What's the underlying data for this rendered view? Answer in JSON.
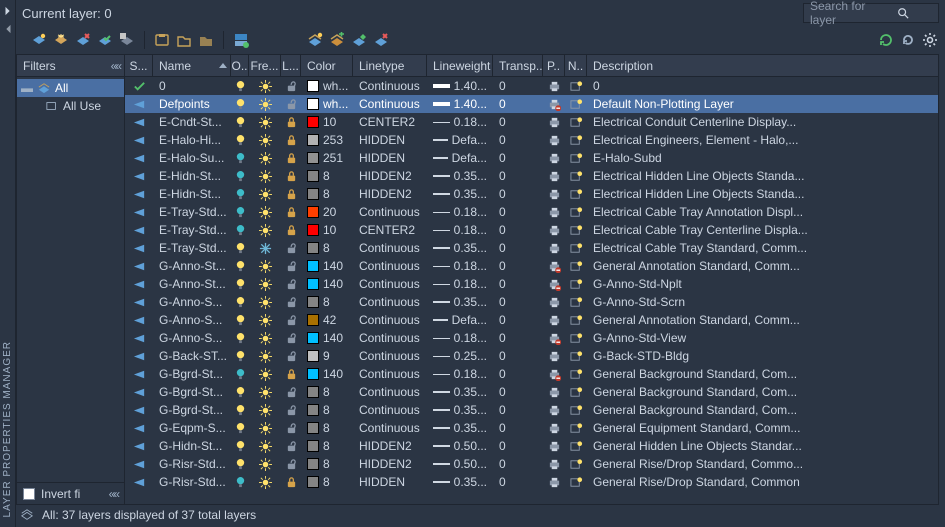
{
  "header": {
    "current_layer_label": "Current layer: 0",
    "search_placeholder": "Search for layer"
  },
  "vertical_label": "LAYER PROPERTIES MANAGER",
  "filters": {
    "title": "Filters",
    "items": [
      {
        "name": "All",
        "selected": true
      },
      {
        "name": "All Use",
        "selected": false
      }
    ],
    "invert_label": "Invert fi"
  },
  "columns": {
    "status": "S...",
    "name": "Name",
    "on": "O..",
    "freeze": "Fre...",
    "lock": "L...",
    "color": "Color",
    "linetype": "Linetype",
    "lineweight": "Lineweight",
    "transp": "Transp...",
    "plotstyle": "P..",
    "newvp": "N..",
    "desc": "Description"
  },
  "rows": [
    {
      "status": "check",
      "name": "0",
      "on": true,
      "freeze": "sun",
      "lock": false,
      "color": "#ffffff",
      "color_label": "wh...",
      "linetype": "Continuous",
      "lw": "1.40...",
      "lw_cls": "thick",
      "transp": "0",
      "plot": "print",
      "desc": "0"
    },
    {
      "status": "layer",
      "name": "Defpoints",
      "on": true,
      "freeze": "sun",
      "lock": false,
      "color": "#ffffff",
      "color_label": "wh...",
      "linetype": "Continuous",
      "lw": "1.40...",
      "lw_cls": "thick",
      "transp": "0",
      "plot": "noprint",
      "desc": "Default Non-Plotting Layer",
      "selected": true
    },
    {
      "status": "layer",
      "name": "E-Cndt-St...",
      "on": true,
      "freeze": "sun",
      "lock": true,
      "color": "#ff0000",
      "color_label": "10",
      "linetype": "CENTER2",
      "lw": "0.18...",
      "lw_cls": "thin",
      "transp": "0",
      "plot": "print",
      "desc": "Electrical Conduit Centerline Display..."
    },
    {
      "status": "layer",
      "name": "E-Halo-Hi...",
      "on": true,
      "freeze": "sun",
      "lock": true,
      "color": "#b2b2b2",
      "color_label": "253",
      "linetype": "HIDDEN",
      "lw": "Defa...",
      "lw_cls": "def",
      "transp": "0",
      "plot": "print",
      "desc": "Electrical Engineers, Element - Halo,..."
    },
    {
      "status": "layer",
      "name": "E-Halo-Su...",
      "on": false,
      "freeze": "sun",
      "lock": true,
      "color": "#919191",
      "color_label": "251",
      "linetype": "HIDDEN",
      "lw": "Defa...",
      "lw_cls": "def",
      "transp": "0",
      "plot": "print",
      "desc": "E-Halo-Subd"
    },
    {
      "status": "layer",
      "name": "E-Hidn-St...",
      "on": false,
      "freeze": "sun",
      "lock": true,
      "color": "#848484",
      "color_label": "8",
      "linetype": "HIDDEN2",
      "lw": "0.35...",
      "lw_cls": "mid",
      "transp": "0",
      "plot": "print",
      "desc": "Electrical Hidden Line Objects Standa..."
    },
    {
      "status": "layer",
      "name": "E-Hidn-St...",
      "on": false,
      "freeze": "sun",
      "lock": true,
      "color": "#848484",
      "color_label": "8",
      "linetype": "HIDDEN2",
      "lw": "0.35...",
      "lw_cls": "mid",
      "transp": "0",
      "plot": "print",
      "desc": "Electrical Hidden Line Objects Standa..."
    },
    {
      "status": "layer",
      "name": "E-Tray-Std...",
      "on": false,
      "freeze": "sun",
      "lock": true,
      "color": "#ff3f00",
      "color_label": "20",
      "linetype": "Continuous",
      "lw": "0.18...",
      "lw_cls": "thin",
      "transp": "0",
      "plot": "print",
      "desc": "Electrical Cable Tray Annotation Displ..."
    },
    {
      "status": "layer",
      "name": "E-Tray-Std...",
      "on": false,
      "freeze": "sun",
      "lock": true,
      "color": "#ff0000",
      "color_label": "10",
      "linetype": "CENTER2",
      "lw": "0.18...",
      "lw_cls": "thin",
      "transp": "0",
      "plot": "print",
      "desc": "Electrical Cable Tray Centerline Displa..."
    },
    {
      "status": "layer",
      "name": "E-Tray-Std...",
      "on": true,
      "freeze": "snow",
      "lock": false,
      "color": "#848484",
      "color_label": "8",
      "linetype": "Continuous",
      "lw": "0.35...",
      "lw_cls": "mid",
      "transp": "0",
      "plot": "print",
      "desc": "Electrical Cable Tray Standard, Comm..."
    },
    {
      "status": "layer",
      "name": "G-Anno-St...",
      "on": true,
      "freeze": "sun",
      "lock": false,
      "color": "#00bfff",
      "color_label": "140",
      "linetype": "Continuous",
      "lw": "0.18...",
      "lw_cls": "thin",
      "transp": "0",
      "plot": "noprint",
      "desc": "General Annotation Standard, Comm..."
    },
    {
      "status": "layer",
      "name": "G-Anno-St...",
      "on": true,
      "freeze": "sun",
      "lock": false,
      "color": "#00bfff",
      "color_label": "140",
      "linetype": "Continuous",
      "lw": "0.18...",
      "lw_cls": "thin",
      "transp": "0",
      "plot": "noprint",
      "desc": "G-Anno-Std-Nplt"
    },
    {
      "status": "layer",
      "name": "G-Anno-S...",
      "on": true,
      "freeze": "sun",
      "lock": false,
      "color": "#848484",
      "color_label": "8",
      "linetype": "Continuous",
      "lw": "0.35...",
      "lw_cls": "mid",
      "transp": "0",
      "plot": "print",
      "desc": "G-Anno-Std-Scrn"
    },
    {
      "status": "layer",
      "name": "G-Anno-S...",
      "on": true,
      "freeze": "sun",
      "lock": false,
      "color": "#a87000",
      "color_label": "42",
      "linetype": "Continuous",
      "lw": "Defa...",
      "lw_cls": "def",
      "transp": "0",
      "plot": "print",
      "desc": "General Annotation Standard, Comm..."
    },
    {
      "status": "layer",
      "name": "G-Anno-S...",
      "on": true,
      "freeze": "sun",
      "lock": false,
      "color": "#00bfff",
      "color_label": "140",
      "linetype": "Continuous",
      "lw": "0.18...",
      "lw_cls": "thin",
      "transp": "0",
      "plot": "noprint",
      "desc": "G-Anno-Std-View"
    },
    {
      "status": "layer",
      "name": "G-Back-ST...",
      "on": true,
      "freeze": "sun",
      "lock": false,
      "color": "#c0c0c0",
      "color_label": "9",
      "linetype": "Continuous",
      "lw": "0.25...",
      "lw_cls": "thin",
      "transp": "0",
      "plot": "print",
      "desc": "G-Back-STD-Bldg"
    },
    {
      "status": "layer",
      "name": "G-Bgrd-St...",
      "on": false,
      "freeze": "sun",
      "lock": true,
      "color": "#00bfff",
      "color_label": "140",
      "linetype": "Continuous",
      "lw": "0.18...",
      "lw_cls": "thin",
      "transp": "0",
      "plot": "noprint",
      "desc": "General Background Standard, Com..."
    },
    {
      "status": "layer",
      "name": "G-Bgrd-St...",
      "on": true,
      "freeze": "sun",
      "lock": false,
      "color": "#848484",
      "color_label": "8",
      "linetype": "Continuous",
      "lw": "0.35...",
      "lw_cls": "mid",
      "transp": "0",
      "plot": "print",
      "desc": "General Background Standard, Com..."
    },
    {
      "status": "layer",
      "name": "G-Bgrd-St...",
      "on": true,
      "freeze": "sun",
      "lock": false,
      "color": "#848484",
      "color_label": "8",
      "linetype": "Continuous",
      "lw": "0.35...",
      "lw_cls": "mid",
      "transp": "0",
      "plot": "print",
      "desc": "General Background Standard, Com..."
    },
    {
      "status": "layer",
      "name": "G-Eqpm-S...",
      "on": true,
      "freeze": "sun",
      "lock": false,
      "color": "#848484",
      "color_label": "8",
      "linetype": "Continuous",
      "lw": "0.35...",
      "lw_cls": "mid",
      "transp": "0",
      "plot": "print",
      "desc": "General Equipment Standard, Comm..."
    },
    {
      "status": "layer",
      "name": "G-Hidn-St...",
      "on": true,
      "freeze": "sun",
      "lock": false,
      "color": "#848484",
      "color_label": "8",
      "linetype": "HIDDEN2",
      "lw": "0.50...",
      "lw_cls": "mid",
      "transp": "0",
      "plot": "print",
      "desc": "General Hidden Line Objects Standar..."
    },
    {
      "status": "layer",
      "name": "G-Risr-Std...",
      "on": true,
      "freeze": "sun",
      "lock": false,
      "color": "#848484",
      "color_label": "8",
      "linetype": "HIDDEN2",
      "lw": "0.50...",
      "lw_cls": "mid",
      "transp": "0",
      "plot": "print",
      "desc": "General Rise/Drop Standard, Commo..."
    },
    {
      "status": "layer",
      "name": "G-Risr-Std...",
      "on": false,
      "freeze": "sun",
      "lock": true,
      "color": "#848484",
      "color_label": "8",
      "linetype": "HIDDEN",
      "lw": "0.35...",
      "lw_cls": "mid",
      "transp": "0",
      "plot": "print",
      "desc": "General Rise/Drop Standard, Common"
    }
  ],
  "status_bar": "All: 37 layers displayed of 37 total layers"
}
